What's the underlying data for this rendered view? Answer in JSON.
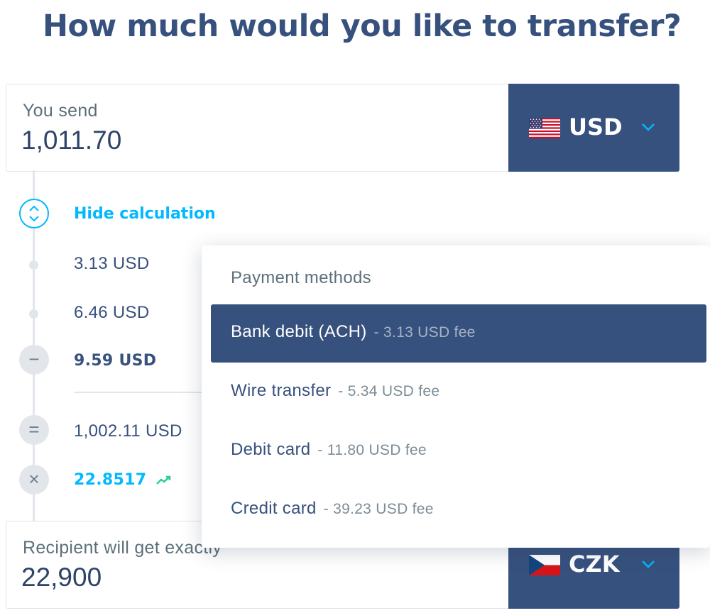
{
  "page": {
    "title": "How much would you like to transfer?"
  },
  "send": {
    "label": "You send",
    "amount": "1,011.70",
    "currency": "USD",
    "flag_icon": "us-flag-icon"
  },
  "calculation": {
    "toggle_label": "Hide calculation",
    "rows": [
      {
        "value": "3.13 USD",
        "marker": "dot"
      },
      {
        "value": "6.46 USD",
        "marker": "dot"
      },
      {
        "value": "9.59 USD",
        "marker": "minus",
        "symbol": "−"
      },
      {
        "value": "1,002.11 USD",
        "marker": "equals",
        "symbol": "="
      },
      {
        "value": "22.8517",
        "marker": "times",
        "symbol": "×",
        "trend_icon": "trend-up-icon"
      }
    ]
  },
  "payment_methods": {
    "title": "Payment methods",
    "options": [
      {
        "name": "Bank debit (ACH)",
        "fee": "- 3.13 USD fee",
        "selected": true
      },
      {
        "name": "Wire transfer",
        "fee": "- 5.34 USD fee",
        "selected": false
      },
      {
        "name": "Debit card",
        "fee": "- 11.80 USD fee",
        "selected": false
      },
      {
        "name": "Credit card",
        "fee": "- 39.23 USD fee",
        "selected": false
      }
    ]
  },
  "receive": {
    "label": "Recipient will get exactly",
    "amount": "22,900",
    "currency": "CZK",
    "flag_icon": "czech-flag-icon"
  },
  "colors": {
    "navy": "#37517e",
    "accent_blue": "#00b9ff",
    "muted_gray": "#5d7079"
  }
}
